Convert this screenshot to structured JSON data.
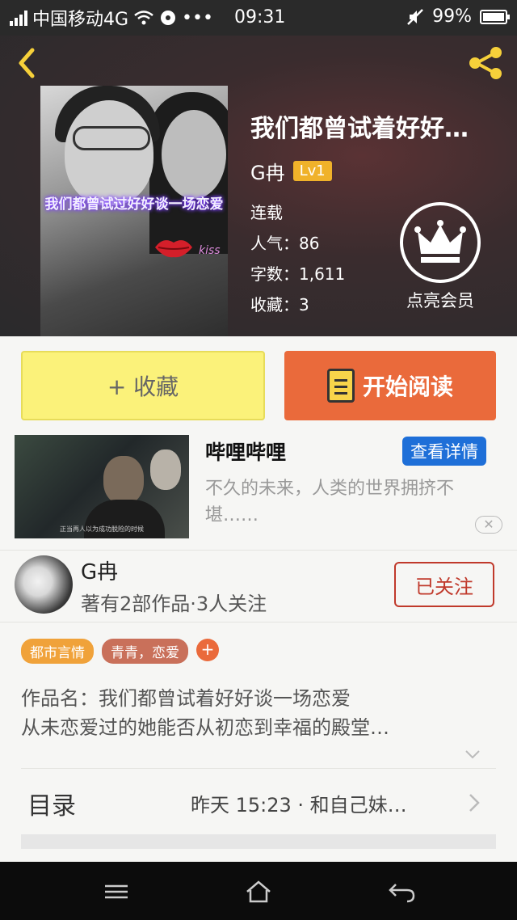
{
  "status_bar": {
    "carrier": "中国移动4G",
    "dots": "•••",
    "time": "09:31",
    "battery": "99%"
  },
  "header": {
    "cover_title": "我们都曾试过好好谈一场恋爱",
    "title": "我们都曾试着好好…",
    "author": "G冉",
    "level": "Lv1",
    "status": "连载",
    "popularity_label": "人气：",
    "popularity": "86",
    "words_label": "字数：",
    "words": "1,611",
    "collect_label": "收藏：",
    "collect": "3",
    "vip_label": "点亮会员",
    "cover_sticker": "kiss"
  },
  "actions": {
    "favorite_label": "+ 收藏",
    "read_label": "开始阅读"
  },
  "ad": {
    "title": "哔哩哔哩",
    "detail_label": "查看详情",
    "description": "不久的未来，人类的世界拥挤不堪……",
    "caption": "正当再人以为成功脱险的时候",
    "close_label": "✕"
  },
  "author": {
    "name": "G冉",
    "stats": "著有2部作品·3人关注",
    "follow_label": "已关注"
  },
  "tags": [
    {
      "label": "都市言情",
      "color": "#f0a23a"
    },
    {
      "label": "青青，恋爱",
      "color": "#c9705a"
    }
  ],
  "tag_add_label": "+",
  "synopsis": {
    "line1": "作品名：我们都曾试着好好谈一场恋爱",
    "line2": "从未恋爱过的她能否从初恋到幸福的殿堂…"
  },
  "toc": {
    "label": "目录",
    "latest": "昨天 15:23 · 和自己妹…"
  },
  "colors": {
    "accent_orange": "#ea6a3b",
    "fav_yellow": "#fbf27a",
    "level_gold": "#f0b22a",
    "ad_blue": "#1e6fd8",
    "follow_red": "#c0392b",
    "back_yellow": "#f6d03a"
  }
}
